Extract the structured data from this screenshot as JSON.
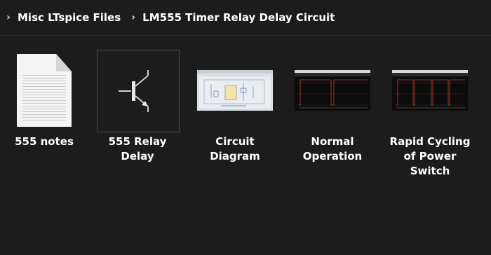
{
  "breadcrumb": {
    "items": [
      {
        "label": "Misc LTspice Files"
      },
      {
        "label": "LM555 Timer Relay Delay Circuit"
      }
    ]
  },
  "files": [
    {
      "name": "555 notes",
      "type": "document",
      "icon": "text-document-icon"
    },
    {
      "name": "555 Relay Delay",
      "type": "schematic",
      "icon": "transistor-symbol-icon",
      "selected": true
    },
    {
      "name": "Circuit Diagram",
      "type": "image",
      "icon": "circuit-screenshot-thumbnail"
    },
    {
      "name": "Normal Operation",
      "type": "image",
      "icon": "waveform-screenshot-thumbnail"
    },
    {
      "name": "Rapid Cycling of Power Switch",
      "type": "image",
      "icon": "waveform-screenshot-thumbnail"
    }
  ],
  "colors": {
    "background": "#1c1c1c",
    "text": "#ffffff",
    "waveform": "#c83a3a"
  }
}
